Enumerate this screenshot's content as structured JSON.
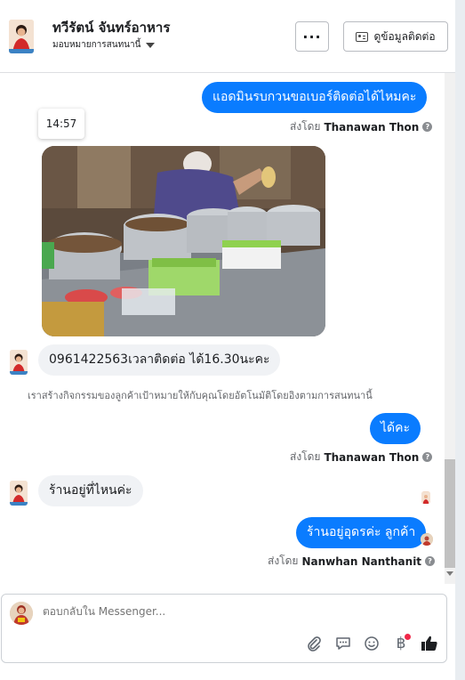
{
  "header": {
    "page_name": "ทวีรัตน์ จันทร์อาหาร",
    "assignment_label": "มอบหมายการสนทนานี้",
    "more_label": "···",
    "contact_info_label": "ดูข้อมูลติดต่อ"
  },
  "messages": {
    "out1_text": "แอดมินรบกวนขอเบอร์ติดต่อได้ไหมคะ",
    "sent_by_prefix": "ส่งโดย",
    "out1_sender": "Thanawan Thon",
    "photo_time": "14:57",
    "in1_text": "0961422563เวลาติดต่อ ได้16.30นะคะ",
    "system_note": "เราสร้างกิจกรรมของลูกค้าเป้าหมายให้กับคุณโดยอัตโนมัติโดยอิงตามการสนทนานี้",
    "out2_text": "ได้คะ",
    "out2_sender": "Thanawan Thon",
    "in2_text": "ร้านอยู่ที่ไหนค่ะ",
    "out3_text": "ร้านอยู่อุดรค่ะ ลูกค้า",
    "out3_sender": "Nanwhan Nanthanit"
  },
  "composer": {
    "placeholder": "ตอบกลับใน Messenger..."
  },
  "icons": [
    "kebab-icon",
    "contact-card-icon",
    "caret-down-icon",
    "help-icon",
    "paperclip-icon",
    "saved-reply-icon",
    "emoji-icon",
    "baht-icon",
    "thumbs-up-icon"
  ],
  "colors": {
    "outgoing_bubble": "#0a7cff",
    "incoming_bubble": "#f0f2f5",
    "notification_dot": "#f02849"
  }
}
